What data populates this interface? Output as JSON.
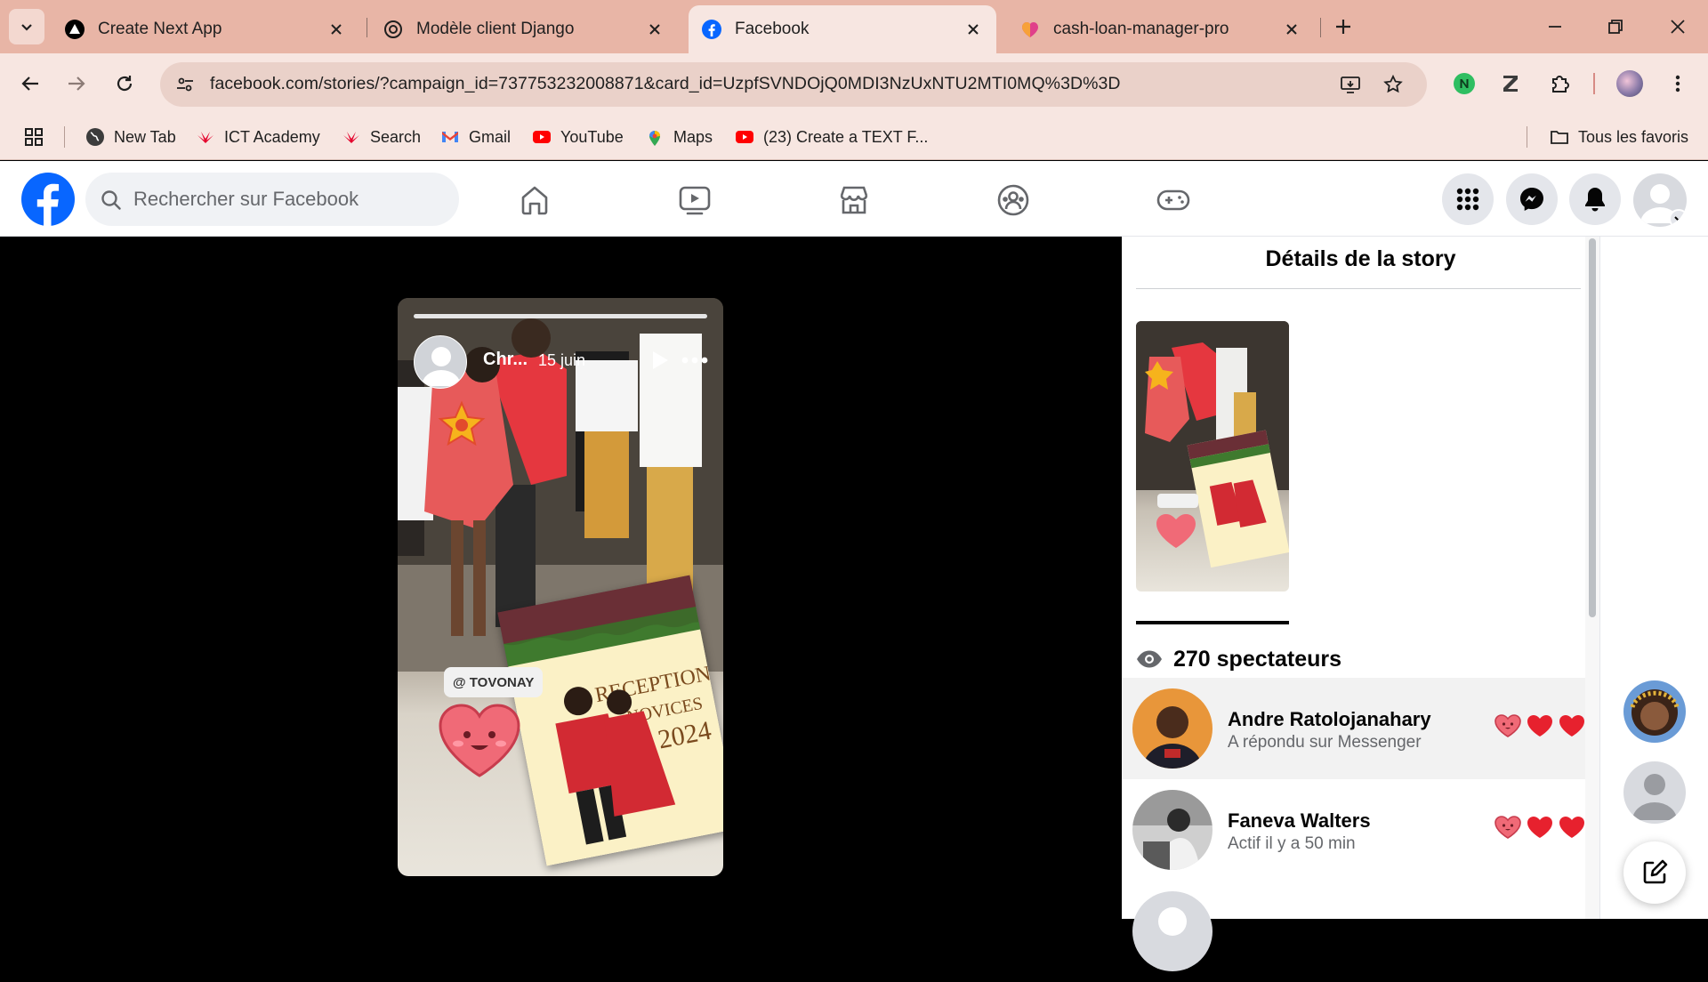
{
  "browser": {
    "tabs": [
      {
        "title": "Create Next App",
        "icon": "nextjs-icon"
      },
      {
        "title": "Modèle client Django",
        "icon": "chatgpt-icon"
      },
      {
        "title": "Facebook",
        "icon": "facebook-icon",
        "active": true
      },
      {
        "title": "cash-loan-manager-pro",
        "icon": "heart-app-icon"
      }
    ],
    "url": "facebook.com/stories/?campaign_id=737753232008871&card_id=UzpfSVNDOjQ0MDI3NzUxNTU2MTI0MQ%3D%3D",
    "bookmarks": [
      {
        "label": "New Tab",
        "icon": "globe-icon"
      },
      {
        "label": "ICT Academy",
        "icon": "huawei-icon"
      },
      {
        "label": "Search",
        "icon": "huawei-icon"
      },
      {
        "label": "Gmail",
        "icon": "gmail-icon"
      },
      {
        "label": "YouTube",
        "icon": "youtube-icon"
      },
      {
        "label": "Maps",
        "icon": "maps-icon"
      },
      {
        "label": "(23) Create a TEXT F...",
        "icon": "youtube-icon"
      }
    ],
    "all_bookmarks_label": "Tous les favoris"
  },
  "facebook": {
    "search_placeholder": "Rechercher sur Facebook",
    "brand_color": "#0866ff"
  },
  "story": {
    "author": "Chr...",
    "date": "15 juin",
    "mention": "@ TOVONAY"
  },
  "details": {
    "title": "Détails de la story",
    "viewers_count": "270 spectateurs",
    "viewers": [
      {
        "name": "Andre Ratolojanahary",
        "status": "A répondu sur Messenger"
      },
      {
        "name": "Faneva Walters",
        "status": "Actif il y a 50 min"
      }
    ]
  }
}
